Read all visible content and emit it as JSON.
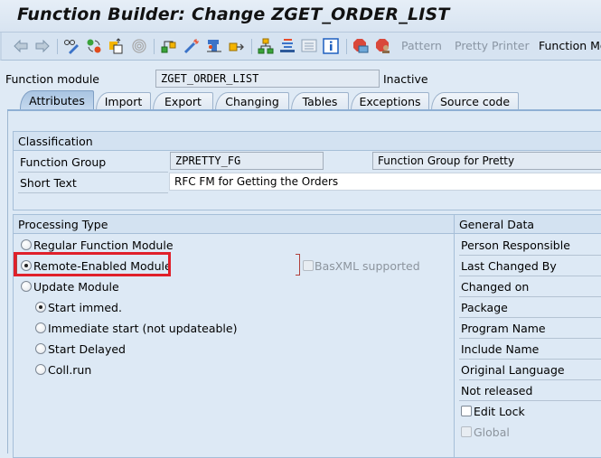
{
  "window": {
    "title": "Function Builder: Change ZGET_ORDER_LIST"
  },
  "toolbar": {
    "icons": [
      "back-arrow-icon",
      "forward-arrow-icon",
      "display-change-icon",
      "other-object-icon",
      "active-inactive-icon",
      "where-used-icon",
      "object-list-icon",
      "check-icon",
      "test-icon",
      "activate-icon",
      "hierarchy-icon",
      "enhancement-icon",
      "info-icon-list",
      "info-icon",
      "set-breakpoint-icon",
      "session-breakpoint-icon"
    ],
    "buttons": {
      "pattern": "Pattern",
      "pretty_printer": "Pretty Printer",
      "function_module_doc": "Function Module Documentation"
    }
  },
  "header": {
    "function_module_label": "Function module",
    "function_module_value": "ZGET_ORDER_LIST",
    "status": "Inactive"
  },
  "tabs": [
    {
      "label": "Attributes",
      "active": true
    },
    {
      "label": "Import",
      "active": false
    },
    {
      "label": "Export",
      "active": false
    },
    {
      "label": "Changing",
      "active": false
    },
    {
      "label": "Tables",
      "active": false
    },
    {
      "label": "Exceptions",
      "active": false
    },
    {
      "label": "Source code",
      "active": false
    }
  ],
  "classification": {
    "title": "Classification",
    "function_group_label": "Function Group",
    "function_group_value": "ZPRETTY_FG",
    "function_group_desc": "Function Group for Pretty",
    "short_text_label": "Short Text",
    "short_text_value": "RFC FM for Getting the Orders"
  },
  "processing_type": {
    "title": "Processing Type",
    "options": [
      {
        "label": "Regular Function Module",
        "selected": false
      },
      {
        "label": "Remote-Enabled Module",
        "selected": true
      },
      {
        "label": "Update Module",
        "selected": false
      }
    ],
    "basxml_label": "BasXML supported",
    "basxml_checked": false,
    "update_options": [
      {
        "label": "Start immed.",
        "selected": true
      },
      {
        "label": "Immediate start (not updateable)",
        "selected": false
      },
      {
        "label": "Start Delayed",
        "selected": false
      },
      {
        "label": "Coll.run",
        "selected": false
      }
    ]
  },
  "general_data": {
    "title": "General Data",
    "fields": [
      "Person Responsible",
      "Last Changed By",
      "Changed on",
      "Package",
      "Program Name",
      "Include Name",
      "Original Language",
      "Not released"
    ],
    "edit_lock_label": "Edit Lock",
    "edit_lock_checked": false,
    "global_label": "Global",
    "global_checked": false
  },
  "annotation": {
    "highlight_color": "#e0202a",
    "highlight_target": "Remote-Enabled Module"
  }
}
